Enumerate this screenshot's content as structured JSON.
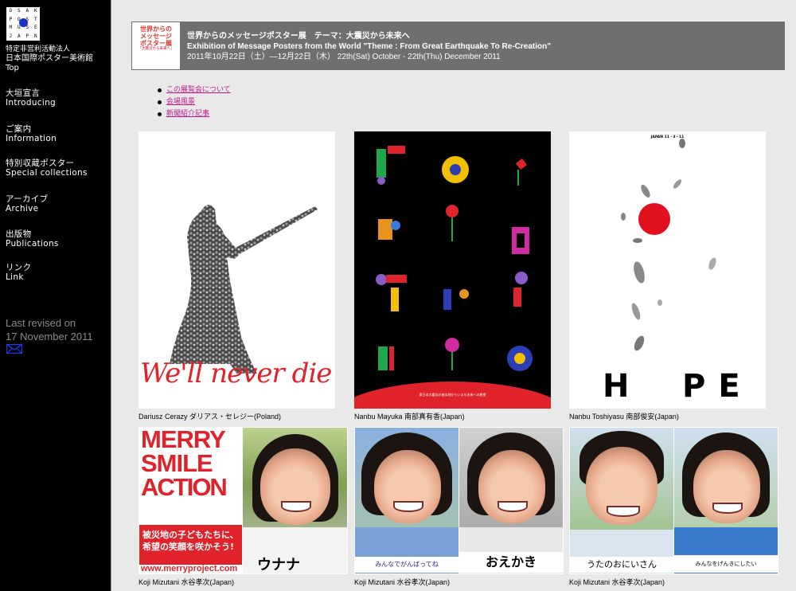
{
  "logo": {
    "letters": [
      "O",
      "S",
      "A",
      "K",
      "P",
      "O",
      "S",
      "T",
      "M",
      "U",
      "S",
      "E",
      "J",
      "A",
      "P",
      "N"
    ]
  },
  "org": {
    "line1": "特定非営利活動法人",
    "line2": "日本国際ポスター美術館",
    "top": "Top"
  },
  "nav": [
    {
      "jp": "大垣宣言",
      "en": "Introducing"
    },
    {
      "jp": "ご案内",
      "en": "Information"
    },
    {
      "jp": "特別収蔵ポスター",
      "en": "Special collections"
    },
    {
      "jp": "アーカイブ",
      "en": "Archive"
    },
    {
      "jp": "出版物",
      "en": "Publications"
    },
    {
      "jp": "リンク",
      "en": "Link"
    }
  ],
  "revised": {
    "line1": "Last revised on",
    "line2": "17 November 2011"
  },
  "banner": {
    "thumb_title_1": "世界からの",
    "thumb_title_2": "メッセージ",
    "thumb_title_3": "ポスター展",
    "thumb_sub": "「大震災から未来へ」",
    "line1": "世界からのメッセージポスター展　テーマ：大震災から未来へ",
    "line2": "Exhibition of Message Posters from the World \"Theme : From Great Earthquake To Re-Creation\"",
    "line3": "2011年10月22日（土）—12月22日（木） 22th(Sat) October - 22th(Thu) December 2011"
  },
  "links": [
    "この展覧会について",
    "会場風景",
    "新聞紹介記事"
  ],
  "posters": {
    "p1": {
      "caption": "Dariusz Cerazy ダリアス・セレジー(Poland)",
      "text": "We'll never die"
    },
    "p2": {
      "caption": "Nanbu Mayuka 南部真有香(Japan)",
      "footer": "東日本大震災の被災地からいまも未来への希望"
    },
    "p3": {
      "caption": "Nanbu Toshiyasu 南部俊安(Japan)",
      "top": "JAPAN 11・3・11",
      "word_left": "H",
      "word_right": "PE"
    },
    "p4": {
      "caption": "Koji Mizutani 水谷孝次(Japan)",
      "line1": "MERRY",
      "line2": "SMILE",
      "line3": "ACTION",
      "jp1": "被災地の子どもたちに、",
      "jp2": "希望の笑顔を咲かそう!",
      "url": "www.merryproject.com",
      "name": "ウナナ"
    },
    "p5": {
      "caption": "Koji Mizutani 水谷孝次(Japan)",
      "left_text": "みんなでがんばってね",
      "right_text": "おえかき"
    },
    "p6": {
      "caption": "Koji Mizutani 水谷孝次(Japan)",
      "left_text": "うたのおにいさん",
      "right_text": "みんなをげんきにしたい"
    }
  },
  "colors": {
    "link": "#c0188c",
    "banner": "#6f6f6f",
    "sidebar": "#000000",
    "red": "#e0222a",
    "mail": "#1a3cff"
  }
}
